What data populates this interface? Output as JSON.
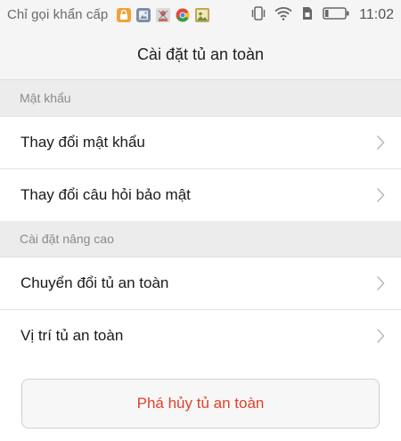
{
  "status_bar": {
    "carrier": "Chỉ gọi khẩn cấp",
    "time": "11:02",
    "notification_icons": [
      "lock-app-icon",
      "gallery-icon",
      "avatar-app-icon",
      "chrome-icon",
      "photo-app-icon"
    ],
    "system_icons": [
      "vibrate-icon",
      "wifi-icon",
      "sim-icon",
      "battery-icon"
    ],
    "colors": {
      "lock_app": "#f0a23a",
      "gallery": "#7d8fa6",
      "chrome_red": "#e04a36",
      "chrome_yellow": "#f2c01b",
      "chrome_green": "#3a9b48",
      "chrome_blue": "#4a86e8"
    }
  },
  "header": {
    "title": "Cài đặt tủ an toàn"
  },
  "sections": [
    {
      "title": "Mật khẩu",
      "items": [
        {
          "label": "Thay đổi mật khẩu"
        },
        {
          "label": "Thay đổi câu hỏi bảo mật"
        }
      ]
    },
    {
      "title": "Cài đặt nâng cao",
      "items": [
        {
          "label": "Chuyển đổi tủ an toàn"
        },
        {
          "label": "Vị trí tủ an toàn"
        }
      ]
    }
  ],
  "actions": {
    "destroy_label": "Phá hủy tủ an toàn",
    "destroy_color": "#e0412b"
  }
}
